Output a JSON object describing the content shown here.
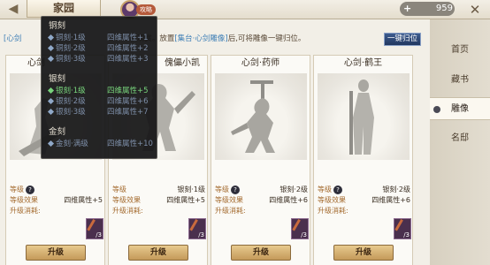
{
  "header": {
    "title": "家园",
    "strategy_label": "攻略",
    "currency_value": "959",
    "currency_plus": "+"
  },
  "hint": {
    "prefix": "[心剑",
    "middle": "放观赏。放置",
    "highlight": "[集台·心剑雕像]",
    "suffix": "后,可将雕像一键归位。"
  },
  "auto_place_button": "一键归位",
  "sidebar": {
    "items": [
      {
        "label": "首页"
      },
      {
        "label": "藏书"
      },
      {
        "label": "雕像"
      },
      {
        "label": "名邸"
      }
    ],
    "active_index": 2
  },
  "cards": [
    {
      "name": "心剑",
      "level_label": "等级",
      "level_value": "",
      "effect_label": "等级效果",
      "effect_value": "",
      "cost_label": "升级消耗:",
      "material_count": "",
      "upgrade_label": "升级"
    },
    {
      "name": "傀儡小凯",
      "level_label": "等级",
      "level_value": "银刻·1级",
      "effect_label": "等级效果",
      "effect_value": "四维属性+5",
      "cost_label": "升级消耗:",
      "material_count": "/3",
      "upgrade_label": "升级"
    },
    {
      "name": "心剑·药师",
      "level_label": "等级",
      "level_value": "银刻·2级",
      "effect_label": "等级效果",
      "effect_value": "四维属性+6",
      "cost_label": "升级消耗:",
      "material_count": "/3",
      "upgrade_label": "升级"
    },
    {
      "name": "心剑·鹤王",
      "level_label": "等级",
      "level_value": "银刻·2级",
      "effect_label": "等级效果",
      "effect_value": "四维属性+6",
      "cost_label": "升级消耗:",
      "material_count": "/3",
      "upgrade_label": "升级"
    }
  ],
  "first_card_effect_value": "四维属性+5",
  "tooltip": {
    "sections": [
      {
        "title": "铜刻",
        "lines": [
          {
            "level": "铜刻·1级",
            "effect": "四维属性+1",
            "style": "dim"
          },
          {
            "level": "铜刻·2级",
            "effect": "四维属性+2",
            "style": "dim"
          },
          {
            "level": "铜刻·3级",
            "effect": "四维属性+3",
            "style": "dim"
          }
        ]
      },
      {
        "title": "银刻",
        "lines": [
          {
            "level": "银刻·1级",
            "effect": "四维属性+5",
            "style": "green"
          },
          {
            "level": "银刻·2级",
            "effect": "四维属性+6",
            "style": "dim"
          },
          {
            "level": "银刻·3级",
            "effect": "四维属性+7",
            "style": "dim"
          }
        ]
      },
      {
        "title": "金刻",
        "lines": [
          {
            "level": "金刻·满级",
            "effect": "四维属性+10",
            "style": "dim"
          }
        ]
      }
    ]
  },
  "colors": {
    "hint_highlight": "#3f7fb6",
    "active_green": "#78d47c",
    "button_gold": "#c49a5a",
    "tooltip_bg": "#141416"
  }
}
